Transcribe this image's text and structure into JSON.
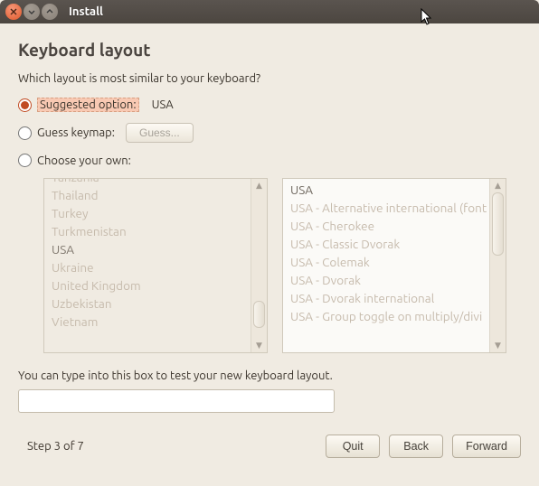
{
  "window": {
    "title": "Install"
  },
  "header": {
    "title": "Keyboard layout",
    "prompt": "Which layout is most similar to your keyboard?"
  },
  "options": {
    "suggested": {
      "label": "Suggested option:",
      "value": "USA"
    },
    "guess": {
      "label": "Guess keymap:",
      "button": "Guess..."
    },
    "choose": {
      "label": "Choose your own:"
    }
  },
  "layouts_left": [
    "Tanzania",
    "Thailand",
    "Turkey",
    "Turkmenistan",
    "USA",
    "Ukraine",
    "United Kingdom",
    "Uzbekistan",
    "Vietnam"
  ],
  "layouts_left_selected_index": 4,
  "layouts_right": [
    "USA",
    "USA - Alternative international (font",
    "USA - Cherokee",
    "USA - Classic Dvorak",
    "USA - Colemak",
    "USA - Dvorak",
    "USA - Dvorak international",
    "USA - Group toggle on multiply/divi"
  ],
  "layouts_right_selected_index": 0,
  "test": {
    "hint": "You can type into this box to test your new keyboard layout.",
    "value": ""
  },
  "footer": {
    "step": "Step 3 of 7",
    "quit": "Quit",
    "back": "Back",
    "forward": "Forward"
  }
}
